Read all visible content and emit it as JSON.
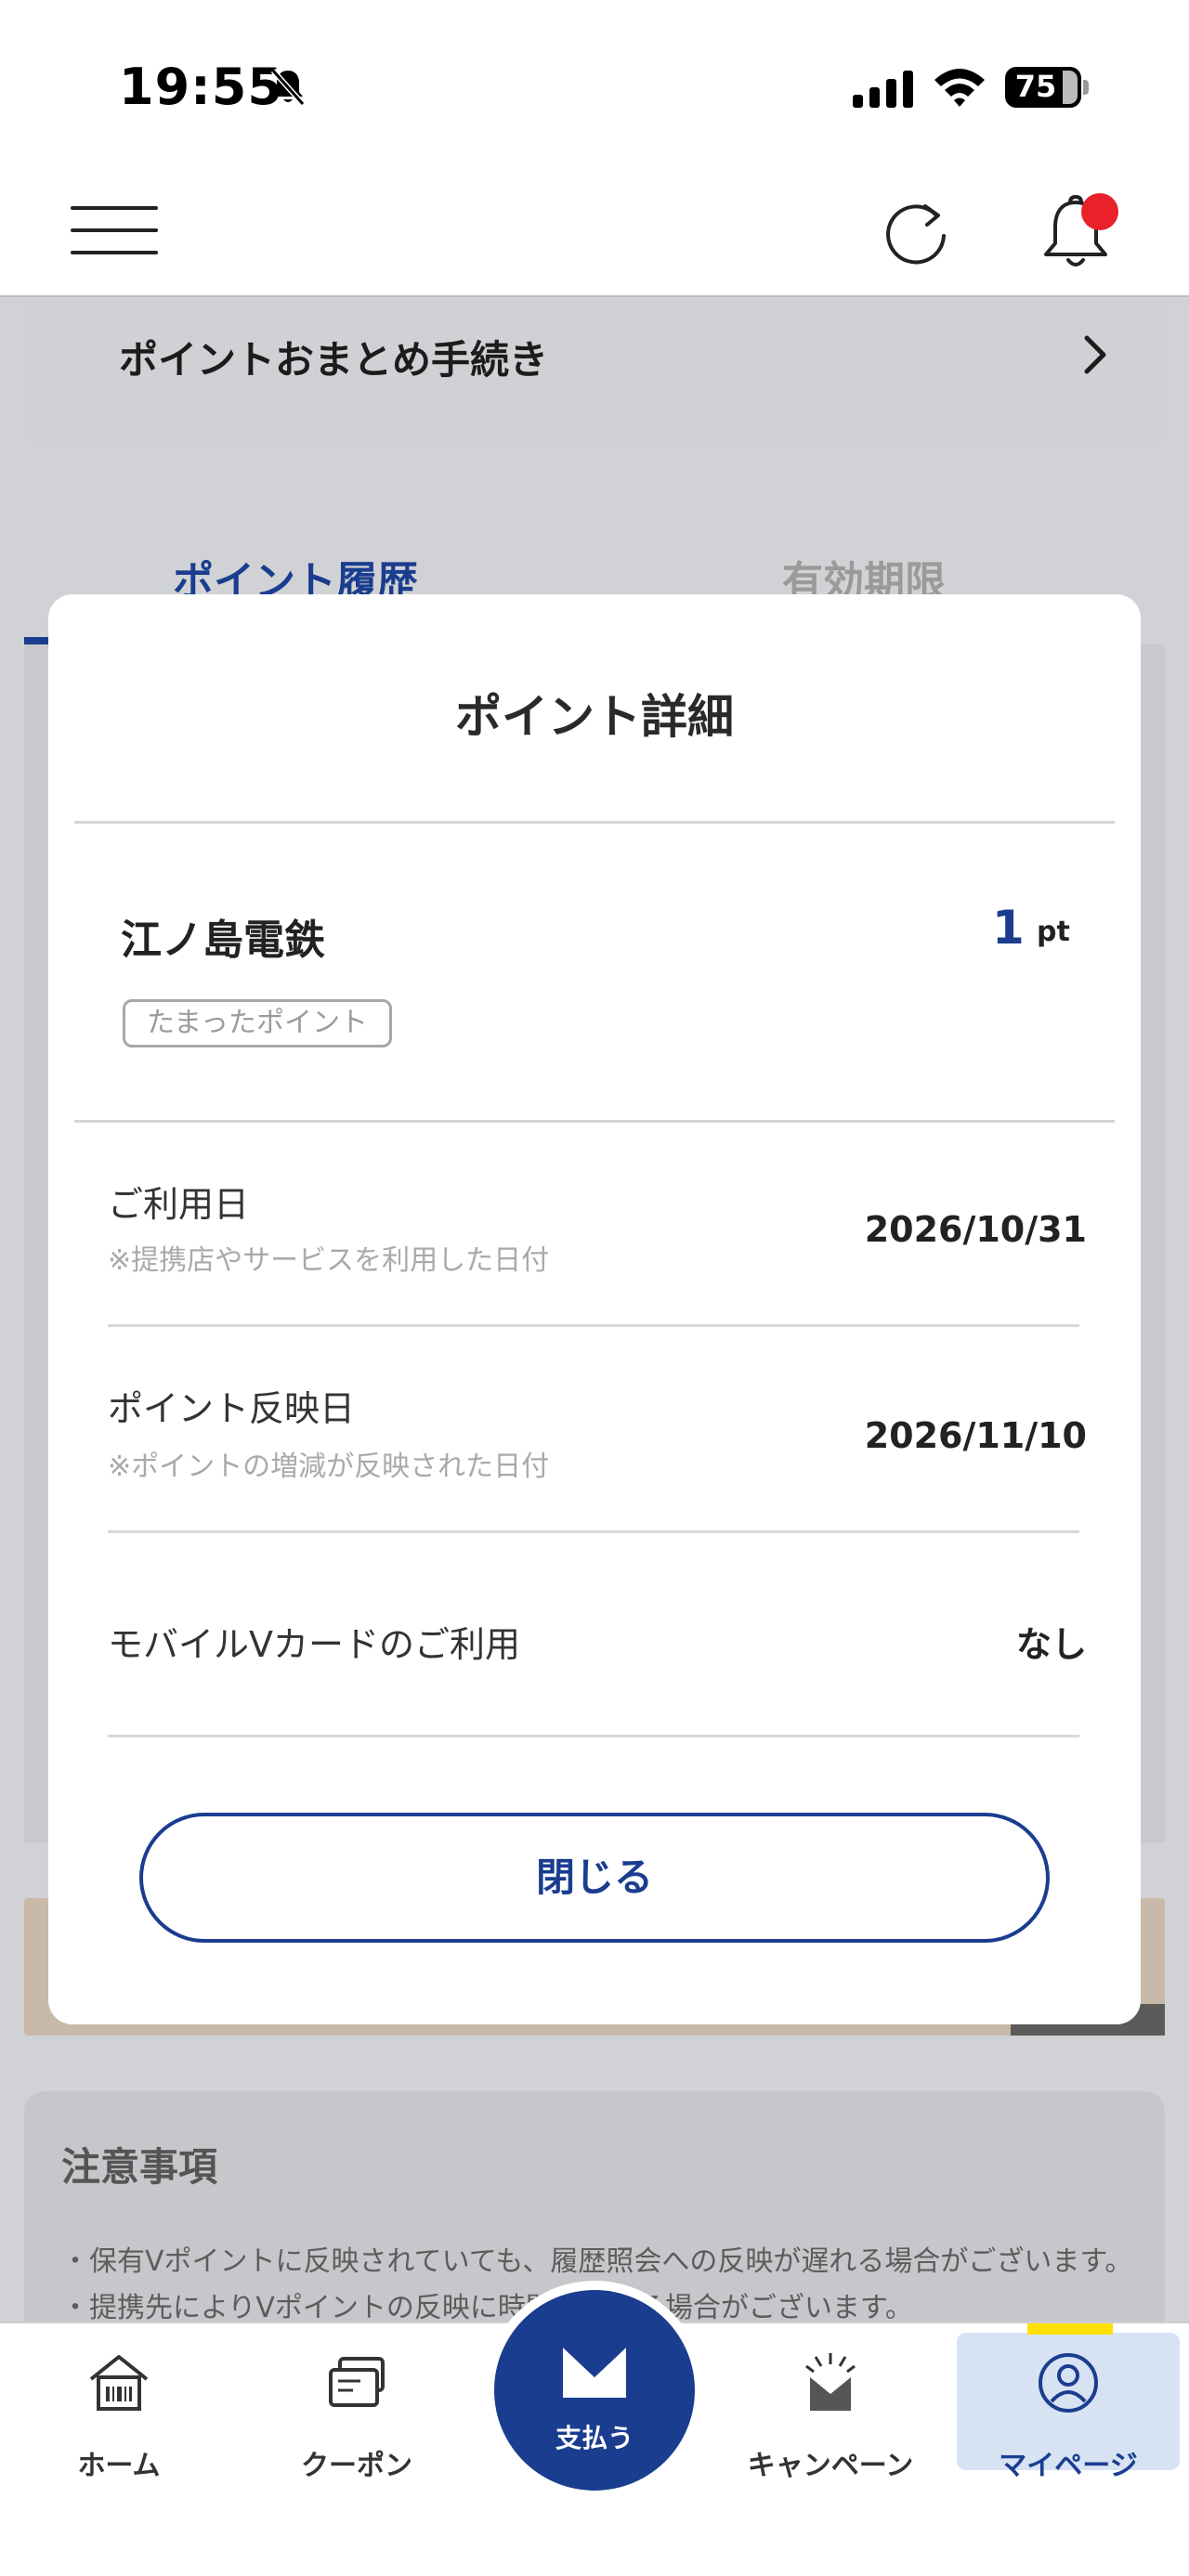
{
  "status_bar": {
    "time": "19:55",
    "battery": "75",
    "icons": [
      "bell-slash-icon",
      "cellular-signal-icon",
      "wifi-icon",
      "battery-icon"
    ]
  },
  "header": {
    "icons": [
      "hamburger-menu-icon",
      "refresh-icon",
      "notification-bell-icon"
    ],
    "notification_dot_color": "#e8212a"
  },
  "background": {
    "card_label": "ポイントおまとめ手続き",
    "tabs": [
      {
        "label": "ポイント履歴",
        "active": true
      },
      {
        "label": "有効期限",
        "active": false
      }
    ],
    "notice_title": "注意事項",
    "notice_lines": [
      "・保有Vポイントに反映されていても、履歴照会への反映が遅れる場合がございます。",
      "・提携先によりVポイントの反映に時間がかかる場合がございます。"
    ]
  },
  "modal": {
    "title": "ポイント詳細",
    "merchant": "江ノ島電鉄",
    "points": "1",
    "points_unit": "pt",
    "tag": "たまったポイント",
    "rows": [
      {
        "label": "ご利用日",
        "note": "※提携店やサービスを利用した日付",
        "value": "2026/10/31"
      },
      {
        "label": "ポイント反映日",
        "note": "※ポイントの増減が反映された日付",
        "value": "2026/11/10"
      },
      {
        "label": "モバイルVカードのご利用",
        "note": "",
        "value": "なし"
      }
    ],
    "close_label": "閉じる"
  },
  "tabbar": {
    "items": [
      {
        "label": "ホーム",
        "icon": "home-icon"
      },
      {
        "label": "クーポン",
        "icon": "coupon-icon"
      },
      {
        "label": "支払う",
        "icon": "pay-icon"
      },
      {
        "label": "キャンペーン",
        "icon": "campaign-icon"
      },
      {
        "label": "マイページ",
        "icon": "user-icon",
        "active": true
      }
    ]
  },
  "colors": {
    "brand_blue": "#1a3d8f",
    "active_tab_bg": "#d7e3f3",
    "active_tab_marker": "#ffe000"
  }
}
